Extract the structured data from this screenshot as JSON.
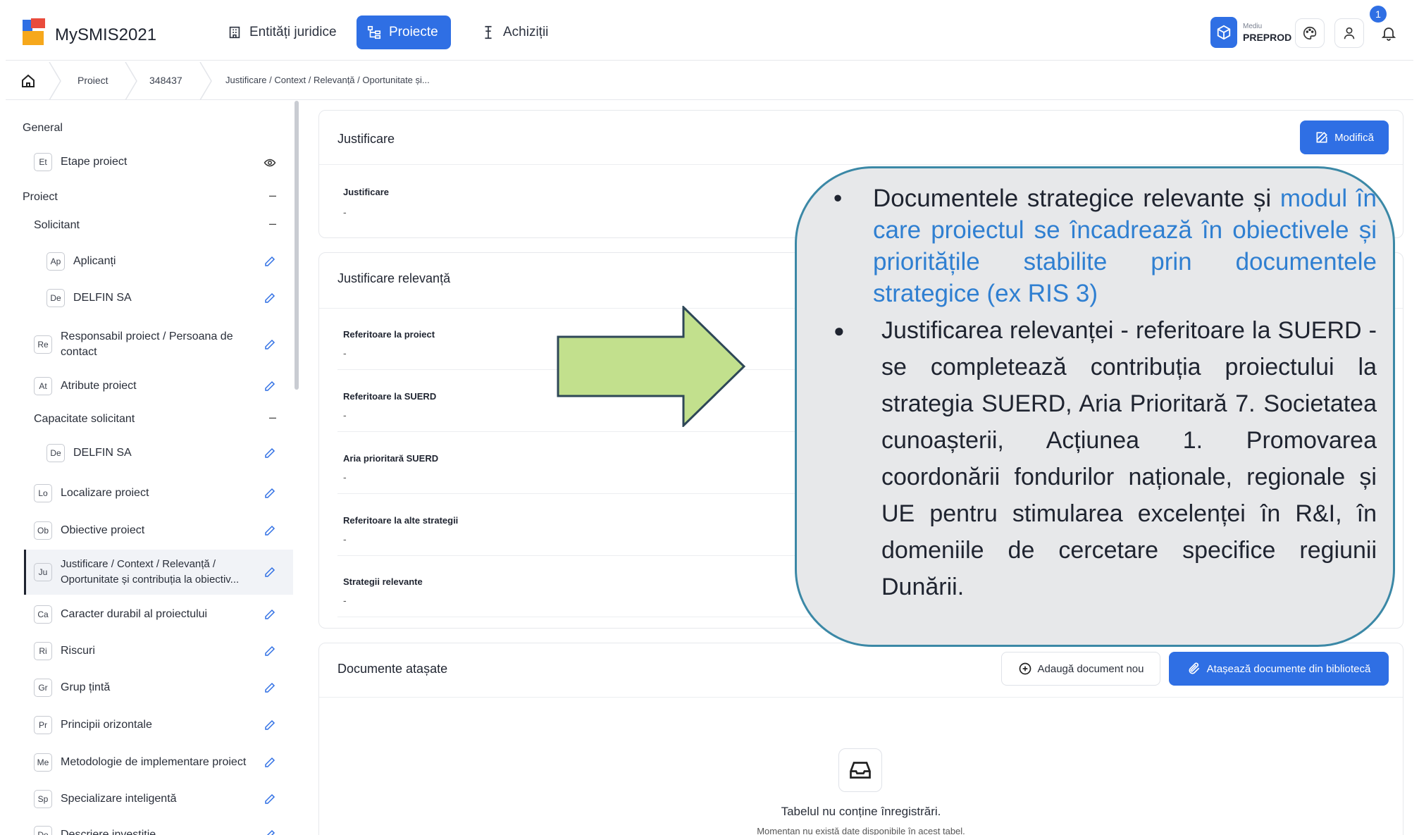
{
  "header": {
    "app_title": "MySMIS2021",
    "nav": [
      "Entități juridice",
      "Proiecte",
      "Achiziții"
    ],
    "env_small": "Mediu",
    "env_big": "PREPROD",
    "notification_count": "1"
  },
  "breadcrumb": [
    "Proiect",
    "348437",
    "Justificare / Context / Relevanță / Oportunitate și..."
  ],
  "sidebar": {
    "general": "General",
    "general_item": {
      "abbr": "Et",
      "label": "Etape proiect"
    },
    "proiect": "Proiect",
    "solicitant": "Solicitant",
    "dash": "–",
    "solicitant_items": [
      {
        "abbr": "Ap",
        "label": "Aplicanți"
      },
      {
        "abbr": "De",
        "label": "DELFIN SA"
      }
    ],
    "items_a": [
      {
        "abbr": "Re",
        "label": "Responsabil proiect / Persoana de contact"
      },
      {
        "abbr": "At",
        "label": "Atribute proiect"
      }
    ],
    "capacitate": "Capacitate solicitant",
    "capacitate_item": {
      "abbr": "De",
      "label": "DELFIN SA"
    },
    "items_b": [
      {
        "abbr": "Lo",
        "label": "Localizare proiect"
      },
      {
        "abbr": "Ob",
        "label": "Obiective proiect"
      },
      {
        "abbr": "Ju",
        "label": "Justificare / Context / Relevanță / Oportunitate și contribuția la obiectiv..."
      },
      {
        "abbr": "Ca",
        "label": "Caracter durabil al proiectului"
      },
      {
        "abbr": "Ri",
        "label": "Riscuri"
      },
      {
        "abbr": "Gr",
        "label": "Grup țintă"
      },
      {
        "abbr": "Pr",
        "label": "Principii orizontale"
      },
      {
        "abbr": "Me",
        "label": "Metodologie de implementare proiect"
      },
      {
        "abbr": "Sp",
        "label": "Specializare inteligentă"
      },
      {
        "abbr": "De",
        "label": "Descriere investiție"
      }
    ]
  },
  "justificare_card": {
    "title": "Justificare",
    "edit_label": "Modifică",
    "field_label": "Justificare",
    "field_value": "-"
  },
  "relevanta_card": {
    "title": "Justificare relevanță",
    "fields": [
      {
        "label": "Referitoare la proiect",
        "value": "-"
      },
      {
        "label": "Referitoare la SUERD",
        "value": "-"
      },
      {
        "label": "Aria prioritară SUERD",
        "value": "-"
      },
      {
        "label": "Referitoare la alte strategii",
        "value": "-"
      },
      {
        "label": "Strategii relevante",
        "value": "-"
      }
    ]
  },
  "documente_card": {
    "title": "Documente atașate",
    "add_label": "Adaugă document nou",
    "attach_label": "Atașează documente din bibliotecă",
    "empty_title": "Tabelul nu conține înregistrări.",
    "empty_sub": "Momentan nu există date disponibile în acest tabel."
  },
  "callout": {
    "bullet1": "•",
    "bullet2": "●",
    "item1_plain": "Documentele strategice relevante și ",
    "item1_highlight": "modul în care proiectul se încadrează în obiectivele și prioritățile stabilite prin documentele strategice (ex RIS 3)",
    "item2": "Justificarea relevanței  - referitoare la SUERD - se completează contribuția proiectului la strategia SUERD, Aria Prioritară 7. Societatea cunoașterii, Acțiunea 1. Promovarea coordonării fondurilor naționale, regionale și UE pentru stimularea excelenței în R&I, în domeniile de cercetare specifice regiunii Dunării."
  },
  "colors": {
    "accent": "#2f6fe4",
    "arrow_fill": "#c2e08d",
    "callout_border": "#3b88a6",
    "callout_text_highlight": "#2f7fd1"
  }
}
